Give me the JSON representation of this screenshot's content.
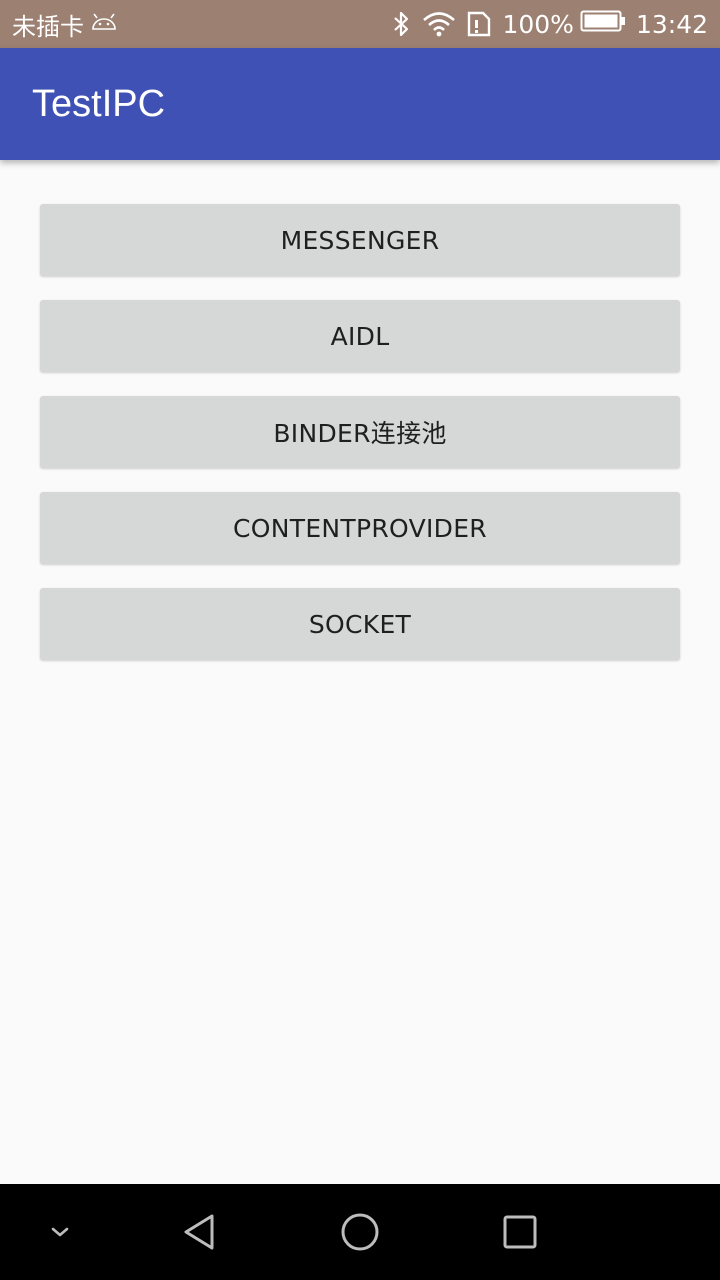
{
  "status_bar": {
    "sim_status": "未插卡",
    "battery_percent": "100%",
    "time": "13:42",
    "icons": [
      "android-debug-icon",
      "bluetooth-icon",
      "wifi-icon",
      "no-sim-icon",
      "battery-icon"
    ]
  },
  "app_bar": {
    "title": "TestIPC"
  },
  "buttons": [
    {
      "label": "MESSENGER"
    },
    {
      "label": "AIDL"
    },
    {
      "label": "BINDER连接池"
    },
    {
      "label": "CONTENTPROVIDER"
    },
    {
      "label": "SOCKET"
    }
  ],
  "nav_bar": {
    "icons": [
      "hide-keyboard-icon",
      "back-icon",
      "home-icon",
      "recents-icon"
    ]
  },
  "colors": {
    "status_bar": "#9c8072",
    "primary": "#3f51b5",
    "button_bg": "#d6d7d7",
    "background": "#fafafa",
    "nav_bar": "#000000"
  }
}
